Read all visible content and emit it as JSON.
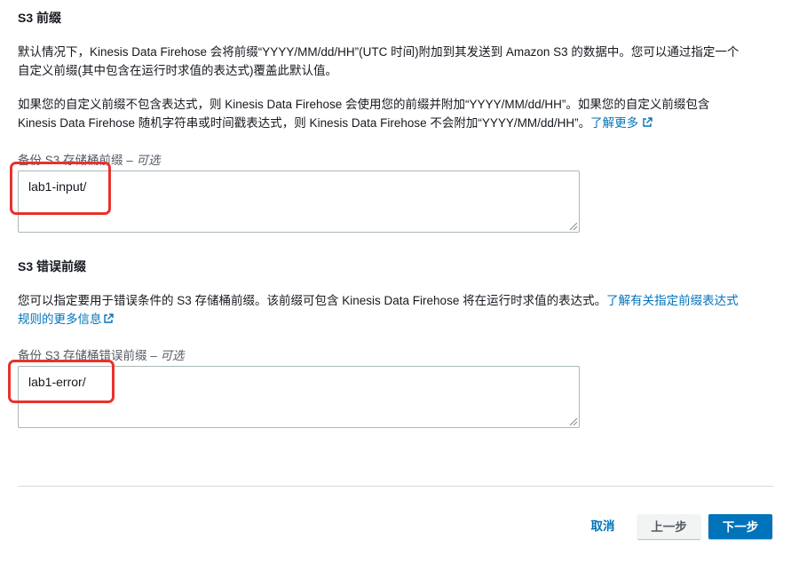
{
  "s3_prefix": {
    "title": "S3 前缀",
    "desc1_line1": "默认情况下，Kinesis Data Firehose 会将前缀“YYYY/MM/dd/HH”(UTC 时间)附加到其发送到 Amazon S3 的数据中。您可以通过指定一个",
    "desc1_line2": "自定义前缀(其中包含在运行时求值的表达式)覆盖此默认值。",
    "desc2_line1": "如果您的自定义前缀不包含表达式，则 Kinesis Data Firehose 会使用您的前缀并附加“YYYY/MM/dd/HH”。如果您的自定义前缀包含",
    "desc2_line2": "Kinesis Data Firehose 随机字符串或时间戳表达式，则 Kinesis Data Firehose 不会附加“YYYY/MM/dd/HH”。",
    "learn_more": "了解更多",
    "field_label": "备份 S3 存储桶前缀 –",
    "optional": "可选",
    "value": "lab1-input/"
  },
  "s3_error_prefix": {
    "title": "S3 错误前缀",
    "desc_line1": "您可以指定要用于错误条件的 S3 存储桶前缀。该前缀可包含 Kinesis Data Firehose 将在运行时求值的表达式。",
    "link_part1": "了解有关指定前缀表达式",
    "link_part2": "规则的更多信息",
    "field_label": "备份 S3 存储桶错误前缀 –",
    "optional": "可选",
    "value": "lab1-error/"
  },
  "footer": {
    "cancel": "取消",
    "previous": "上一步",
    "next": "下一步"
  },
  "colors": {
    "link": "#0073bb",
    "primary": "#0073bb",
    "highlight": "#e8322c"
  }
}
